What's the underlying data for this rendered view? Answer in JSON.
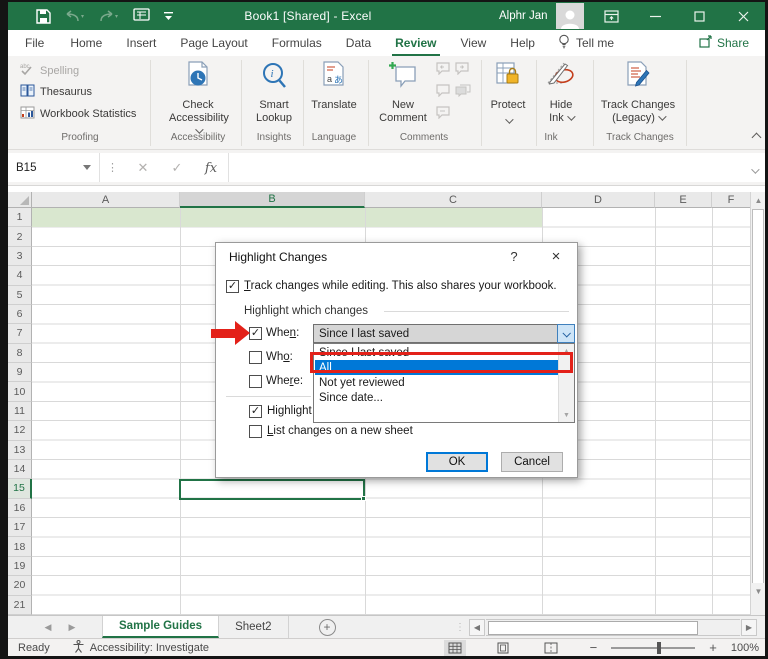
{
  "titlebar": {
    "title": "Book1 [Shared]  -  Excel",
    "user": "Alphr Jan"
  },
  "menu": {
    "items": [
      "File",
      "Home",
      "Insert",
      "Page Layout",
      "Formulas",
      "Data",
      "Review",
      "View",
      "Help"
    ],
    "active": "Review",
    "tellme": "Tell me",
    "share": "Share"
  },
  "ribbon": {
    "proofing": {
      "label": "Proofing",
      "buttons": [
        "Spelling",
        "Thesaurus",
        "Workbook Statistics"
      ]
    },
    "accessibility": {
      "label": "Accessibility",
      "line1": "Check",
      "line2": "Accessibility"
    },
    "insights": {
      "label": "Insights",
      "line1": "Smart",
      "line2": "Lookup"
    },
    "language": {
      "label": "Language",
      "button": "Translate"
    },
    "comments": {
      "label": "Comments",
      "line1": "New",
      "line2": "Comment"
    },
    "protect": {
      "button": "Protect"
    },
    "ink": {
      "label": "Ink",
      "line1": "Hide",
      "line2": "Ink"
    },
    "track": {
      "label": "Track Changes",
      "line1": "Track Changes",
      "line2": "(Legacy)"
    }
  },
  "formula": {
    "name_box": "B15",
    "fx": "fx"
  },
  "grid": {
    "columns": [
      "A",
      "B",
      "C",
      "D",
      "E",
      "F"
    ],
    "rows": [
      "1",
      "2",
      "3",
      "4",
      "5",
      "6",
      "7",
      "8",
      "9",
      "10",
      "11",
      "12",
      "13",
      "14",
      "15",
      "16",
      "17",
      "18",
      "19",
      "20",
      "21"
    ],
    "selected_cell": "B15",
    "row1_fill": "#d9e7cf"
  },
  "dialog": {
    "title": "Highlight Changes",
    "track_u": "T",
    "track_rest": "rack changes while editing. This also shares your workbook.",
    "group_label": "Highlight which changes",
    "when_pre": "Whe",
    "when_u": "n",
    "when_post": ":",
    "who_pre": "Wh",
    "who_u": "o",
    "who_post": ":",
    "where_pre": "Whe",
    "where_u": "r",
    "where_post": "e:",
    "combo_value": "Since I last saved",
    "list_items": [
      "Since I last saved",
      "All",
      "Not yet reviewed",
      "Since date..."
    ],
    "highlighted_item": "All",
    "highlight_label": "Highlight",
    "list_u": "L",
    "list_rest": "ist changes on a new sheet",
    "ok": "OK",
    "cancel": "Cancel"
  },
  "sheet_tabs": {
    "tabs": [
      "Sample Guides",
      "Sheet2"
    ],
    "active": "Sample Guides"
  },
  "status": {
    "ready": "Ready",
    "accessibility": "Accessibility: Investigate",
    "zoom": "100%"
  },
  "colors": {
    "accent": "#217346",
    "selection": "#0078d7",
    "annotation": "#e32119"
  }
}
